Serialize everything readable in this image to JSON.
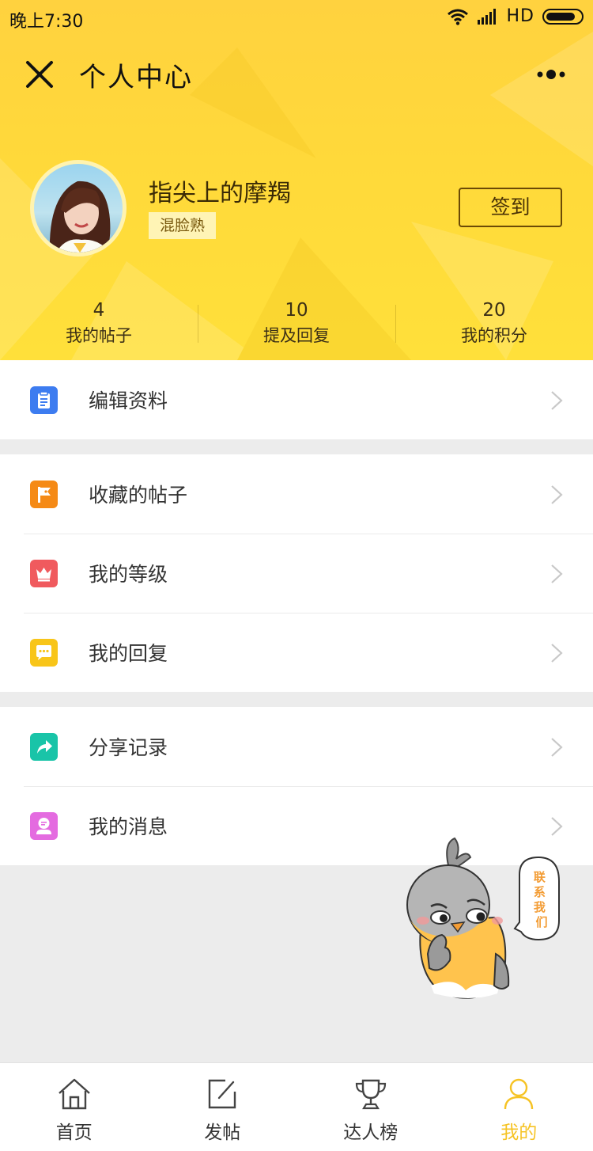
{
  "status_bar": {
    "time": "晚上7:30",
    "network": "HD",
    "battery_level": 0.85
  },
  "header": {
    "title": "个人中心",
    "close_icon": "close-icon",
    "more_icon": "more-icon"
  },
  "profile": {
    "name": "指尖上的摩羯",
    "level": "混脸熟",
    "sign_in_label": "签到"
  },
  "stats": [
    {
      "value": "4",
      "label": "我的帖子"
    },
    {
      "value": "10",
      "label": "提及回复"
    },
    {
      "value": "20",
      "label": "我的积分"
    }
  ],
  "menu_groups": [
    [
      {
        "label": "编辑资料",
        "icon": "clipboard-icon",
        "color": "#3d7cf0"
      }
    ],
    [
      {
        "label": "收藏的帖子",
        "icon": "flag-icon",
        "color": "#f58a16"
      },
      {
        "label": "我的等级",
        "icon": "crown-icon",
        "color": "#f05a5e"
      },
      {
        "label": "我的回复",
        "icon": "chat-bubble-icon",
        "color": "#f8c519"
      }
    ],
    [
      {
        "label": "分享记录",
        "icon": "share-arrow-icon",
        "color": "#19c4a8"
      },
      {
        "label": "我的消息",
        "icon": "message-icon",
        "color": "#e46be0"
      }
    ]
  ],
  "mascot": {
    "bubble_text": "联系我们"
  },
  "tabbar": [
    {
      "label": "首页",
      "icon": "home-icon",
      "active": false
    },
    {
      "label": "发帖",
      "icon": "compose-icon",
      "active": false
    },
    {
      "label": "达人榜",
      "icon": "trophy-icon",
      "active": false
    },
    {
      "label": "我的",
      "icon": "user-icon",
      "active": true
    }
  ],
  "colors": {
    "header_yellow": "#ffd93a",
    "accent": "#f6c324",
    "background": "#ececec"
  }
}
